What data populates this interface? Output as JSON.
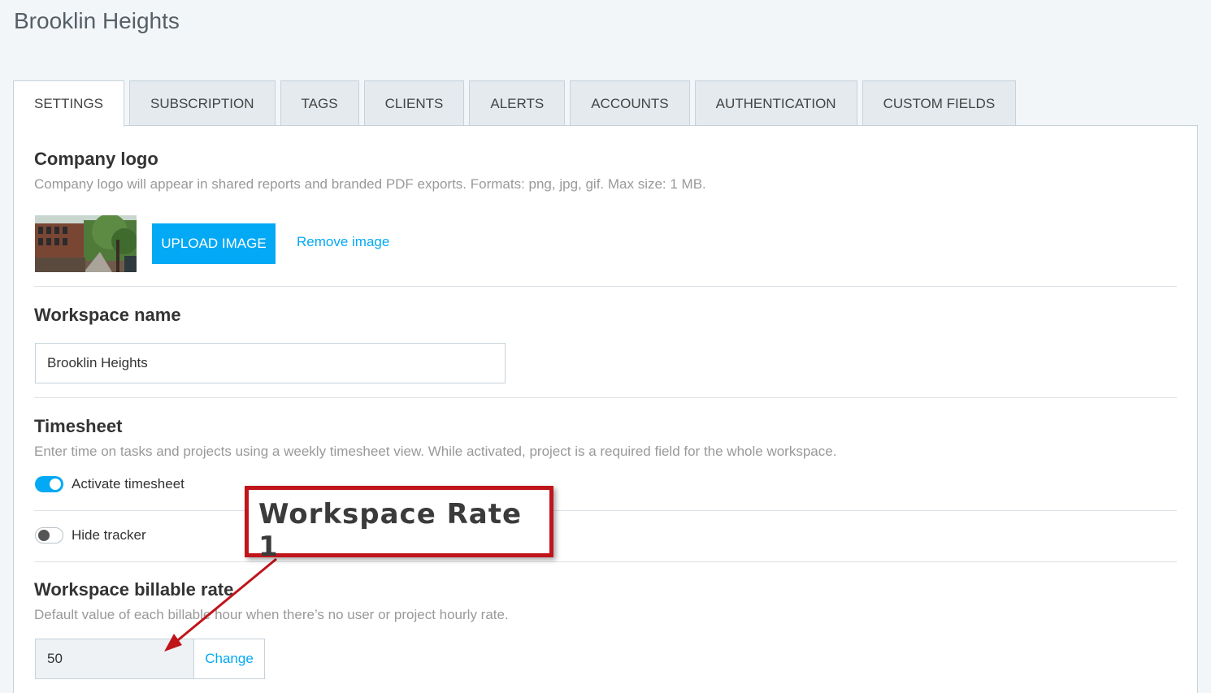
{
  "header": {
    "title": "Brooklin Heights"
  },
  "tabs": [
    {
      "label": "SETTINGS",
      "active": true
    },
    {
      "label": "SUBSCRIPTION",
      "active": false
    },
    {
      "label": "TAGS",
      "active": false
    },
    {
      "label": "CLIENTS",
      "active": false
    },
    {
      "label": "ALERTS",
      "active": false
    },
    {
      "label": "ACCOUNTS",
      "active": false
    },
    {
      "label": "AUTHENTICATION",
      "active": false
    },
    {
      "label": "CUSTOM FIELDS",
      "active": false
    }
  ],
  "company_logo": {
    "title": "Company logo",
    "description": "Company logo will appear in shared reports and branded PDF exports. Formats: png, jpg, gif. Max size: 1 MB.",
    "upload_label": "UPLOAD IMAGE",
    "remove_label": "Remove image"
  },
  "workspace_name": {
    "title": "Workspace name",
    "value": "Brooklin Heights"
  },
  "timesheet": {
    "title": "Timesheet",
    "description": "Enter time on tasks and projects using a weekly timesheet view. While activated, project is a required field for the whole workspace.",
    "activate_label": "Activate timesheet",
    "activate_on": true,
    "hide_tracker_label": "Hide tracker",
    "hide_tracker_on": false
  },
  "billable_rate": {
    "title": "Workspace billable rate",
    "description": "Default value of each billable hour when there’s no user or project hourly rate.",
    "value": "50",
    "change_label": "Change"
  },
  "annotation": {
    "text": "Workspace Rate 1",
    "color": "#c0141b"
  },
  "colors": {
    "accent": "#03a9f4",
    "background": "#f2f6f8"
  }
}
